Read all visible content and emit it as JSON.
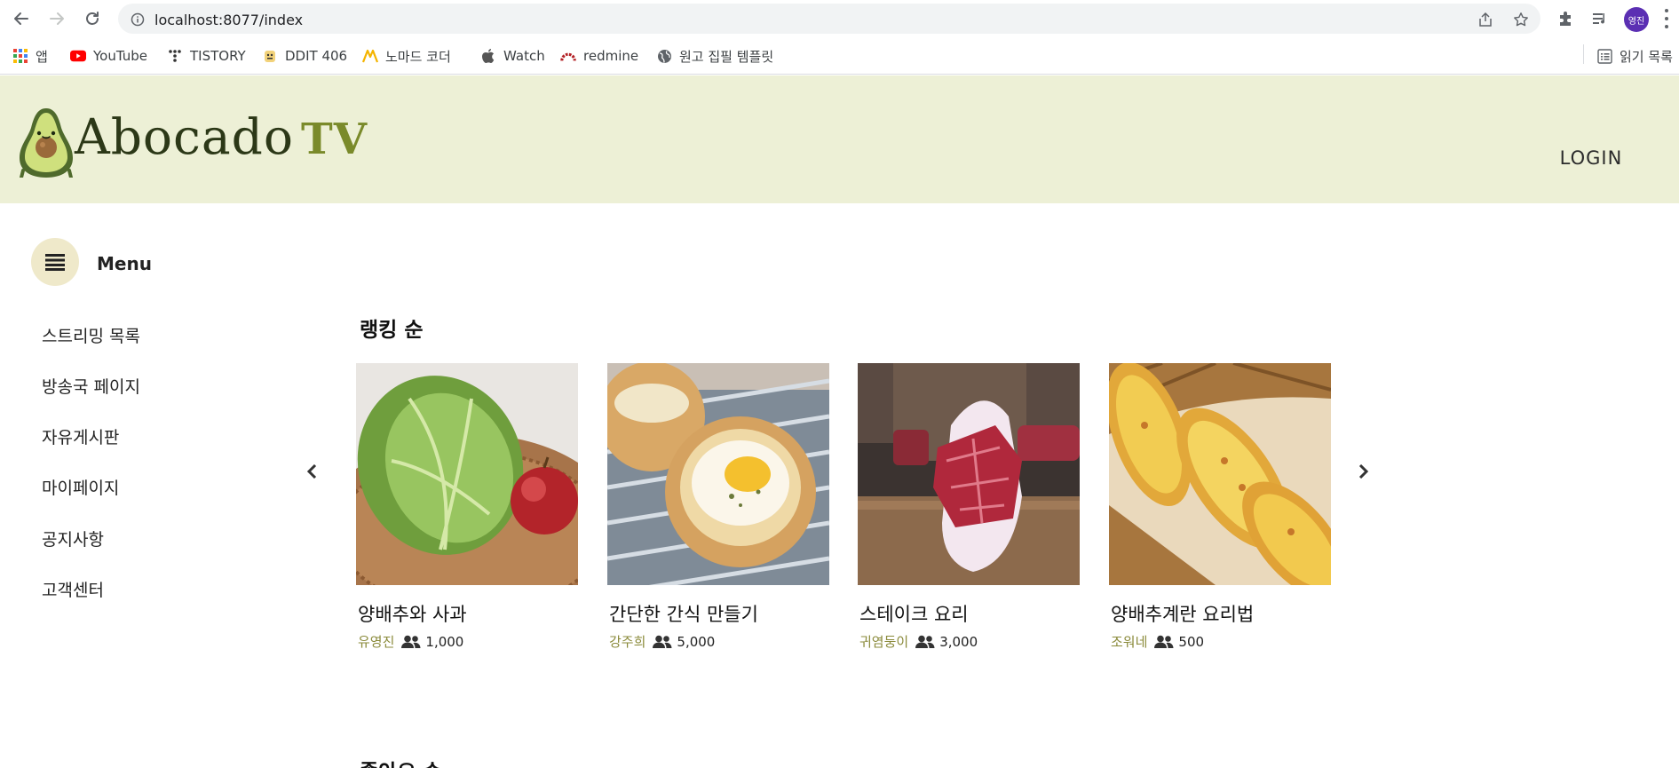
{
  "browser": {
    "url": "localhost:8077/index",
    "profile_initials": "영진",
    "bookmarks": [
      {
        "label": "앱",
        "icon": "apps-grid-icon"
      },
      {
        "label": "YouTube",
        "icon": "youtube-icon"
      },
      {
        "label": "TISTORY",
        "icon": "tistory-icon"
      },
      {
        "label": "DDIT 406",
        "icon": "ddit-icon"
      },
      {
        "label": "노마드 코더",
        "icon": "nomad-coder-icon"
      },
      {
        "label": "Watch",
        "icon": "apple-icon"
      },
      {
        "label": "redmine",
        "icon": "redmine-icon"
      },
      {
        "label": "원고 집필 템플릿",
        "icon": "globe-icon"
      }
    ],
    "reading_list": "읽기 목록"
  },
  "site": {
    "logo": {
      "name": "Abocado",
      "suffix": "TV"
    },
    "login_label": "LOGIN",
    "colors": {
      "header_bg": "#edf0d6",
      "accent_olive": "#8a8a3a",
      "menu_circle": "#efe9ca"
    }
  },
  "sidebar": {
    "menu_label": "Menu",
    "items": [
      {
        "label": "스트리밍 목록"
      },
      {
        "label": "방송국 페이지"
      },
      {
        "label": "자유게시판"
      },
      {
        "label": "마이페이지"
      },
      {
        "label": "공지사항"
      },
      {
        "label": "고객센터"
      }
    ]
  },
  "sections": {
    "ranking": {
      "title": "랭킹 순",
      "cards": [
        {
          "title": "양배추와 사과",
          "author": "유영진",
          "viewers": "1,000",
          "image": "cabbage-apple"
        },
        {
          "title": "간단한 간식 만들기",
          "author": "강주희",
          "viewers": "5,000",
          "image": "egg-bread"
        },
        {
          "title": "스테이크 요리",
          "author": "귀염둥이",
          "viewers": "3,000",
          "image": "steak"
        },
        {
          "title": "양배추계란 요리법",
          "author": "조워네",
          "viewers": "500",
          "image": "egg-rolls"
        }
      ]
    },
    "likes": {
      "title": "좋아요 순"
    }
  }
}
